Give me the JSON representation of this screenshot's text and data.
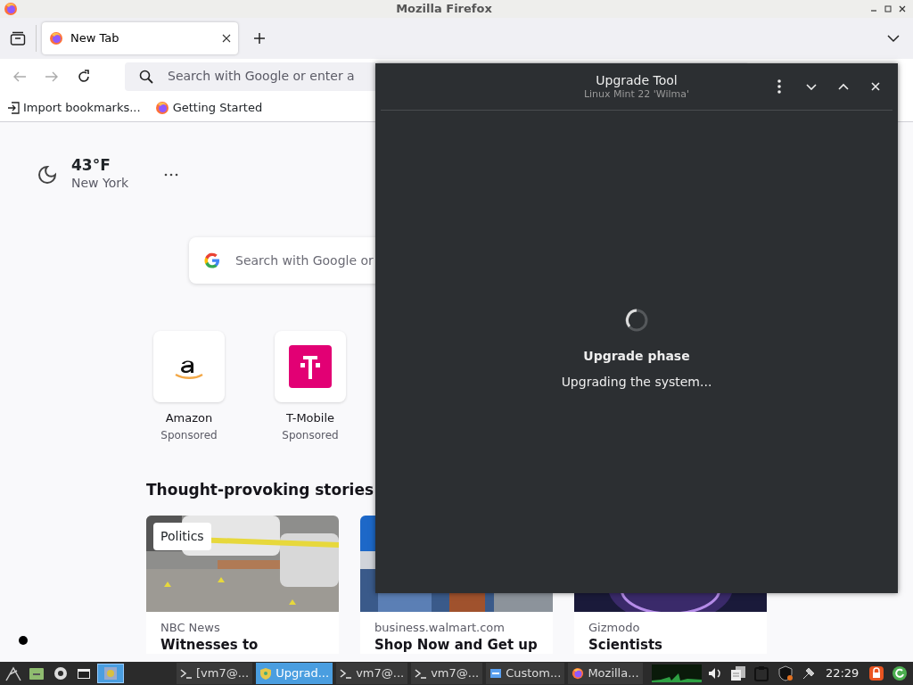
{
  "firefox": {
    "title": "Mozilla Firefox",
    "tabs": [
      {
        "label": "New Tab",
        "selected": true
      }
    ],
    "address_placeholder": "Search with Google or enter a",
    "bookmarks": [
      {
        "kind": "import",
        "label": "Import bookmarks..."
      },
      {
        "kind": "site",
        "label": "Getting Started"
      }
    ],
    "weather": {
      "temperature": "43°F",
      "city": "New York"
    },
    "search_placeholder": "Search with Google or",
    "top_sites": [
      {
        "kind": "amazon",
        "name": "Amazon",
        "label": "Sponsored"
      },
      {
        "kind": "tmobile",
        "name": "T-Mobile",
        "label": "Sponsored"
      }
    ],
    "stories_heading": "Thought-provoking stories",
    "stories": [
      {
        "kind": "street",
        "tag": "Politics",
        "source": "NBC News",
        "headline": "Witnesses to"
      },
      {
        "kind": "store",
        "source": "business.walmart.com",
        "headline": "Shop Now and Get up"
      },
      {
        "kind": "space",
        "source": "Gizmodo",
        "headline": "Scientists"
      }
    ]
  },
  "upgrade_tool": {
    "title": "Upgrade Tool",
    "subtitle": "Linux Mint 22 'Wilma'",
    "phase": "Upgrade phase",
    "status": "Upgrading the system..."
  },
  "taskbar": {
    "tasks": [
      {
        "kind": "terminal",
        "label": "[vm7@...",
        "selected": false
      },
      {
        "kind": "shield",
        "label": "Upgrad...",
        "selected": true
      },
      {
        "kind": "terminal",
        "label": "vm7@...",
        "selected": false
      },
      {
        "kind": "terminal",
        "label": "vm7@...",
        "selected": false
      },
      {
        "kind": "folder",
        "label": "Custom...",
        "selected": false
      },
      {
        "kind": "firefox",
        "label": "Mozilla...",
        "selected": false
      }
    ],
    "clock": "22:29"
  }
}
